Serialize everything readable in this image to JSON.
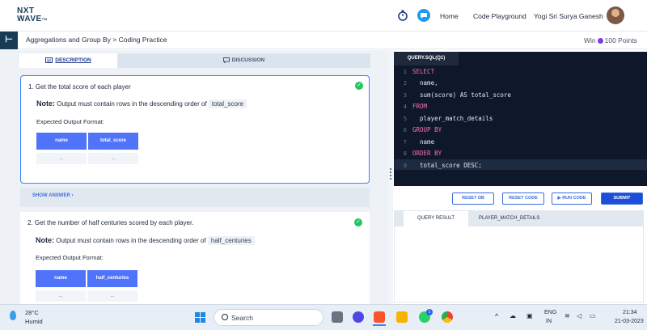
{
  "topnav": {
    "logo_line1": "NXT",
    "logo_line2": "WAVE",
    "logo_tm": "TM",
    "home": "Home",
    "code_playground": "Code Playground",
    "user_name": "Yogi Sri Surya Ganesh"
  },
  "subbar": {
    "menu_glyph": "⊢",
    "breadcrumb": "Aggregations and Group By > Coding Practice",
    "points_prefix": "Win",
    "points_value": "100 Points"
  },
  "tabs": {
    "description": "DESCRIPTION",
    "discussion": "DISCUSSION"
  },
  "questions": [
    {
      "title": "1.  Get the total score of each player",
      "note_label": "Note:",
      "note_text": "Output must contain rows in the descending order of",
      "note_code": "total_score",
      "expected": "Expected Output Format:",
      "headers": [
        "name",
        "total_score"
      ],
      "cells": [
        "...",
        "..."
      ]
    },
    {
      "title": "2.  Get the number of half centuries scored by each player.",
      "note_label": "Note:",
      "note_text": "Output must contain rows in the descending order of",
      "note_code": "half_centuries",
      "expected": "Expected Output Format:",
      "headers": [
        "name",
        "half_centuries"
      ],
      "cells": [
        "...",
        "..."
      ]
    }
  ],
  "show_answer": "SHOW ANSWER ›",
  "editor": {
    "tab": "QUERY.SQL(Q1)",
    "lines": [
      {
        "n": "1",
        "kw": "SELECT",
        "rest": ""
      },
      {
        "n": "2",
        "kw": "",
        "rest": "  name,"
      },
      {
        "n": "3",
        "kw": "",
        "rest": "  sum(score) AS total_score"
      },
      {
        "n": "4",
        "kw": "FROM",
        "rest": ""
      },
      {
        "n": "5",
        "kw": "",
        "rest": "  player_match_details"
      },
      {
        "n": "6",
        "kw": "GROUP BY",
        "rest": ""
      },
      {
        "n": "7",
        "kw": "",
        "rest": "  name"
      },
      {
        "n": "8",
        "kw": "ORDER BY",
        "rest": ""
      },
      {
        "n": "9",
        "kw": "",
        "rest": "  total_score DESC;"
      }
    ]
  },
  "buttons": {
    "reset_db": "RESET DB",
    "reset_code": "RESET CODE",
    "run_code": "▶ RUN CODE",
    "submit": "SUBMIT"
  },
  "results": {
    "tab1": "QUERY RESULT",
    "tab2": "PLAYER_MATCH_DETAILS"
  },
  "taskbar": {
    "temp": "28°C",
    "weather": "Humid",
    "search": "Search",
    "lang1": "ENG",
    "lang2": "IN",
    "time": "21:34",
    "date": "21-03-2023",
    "tray_chevron": "^",
    "whatsapp_badge": "1"
  },
  "colors": {
    "accent": "#3b6fd8",
    "table_header": "#4f74f9",
    "editor_bg": "#0f172a",
    "check": "#22c55e",
    "submit": "#1d4ed8"
  }
}
